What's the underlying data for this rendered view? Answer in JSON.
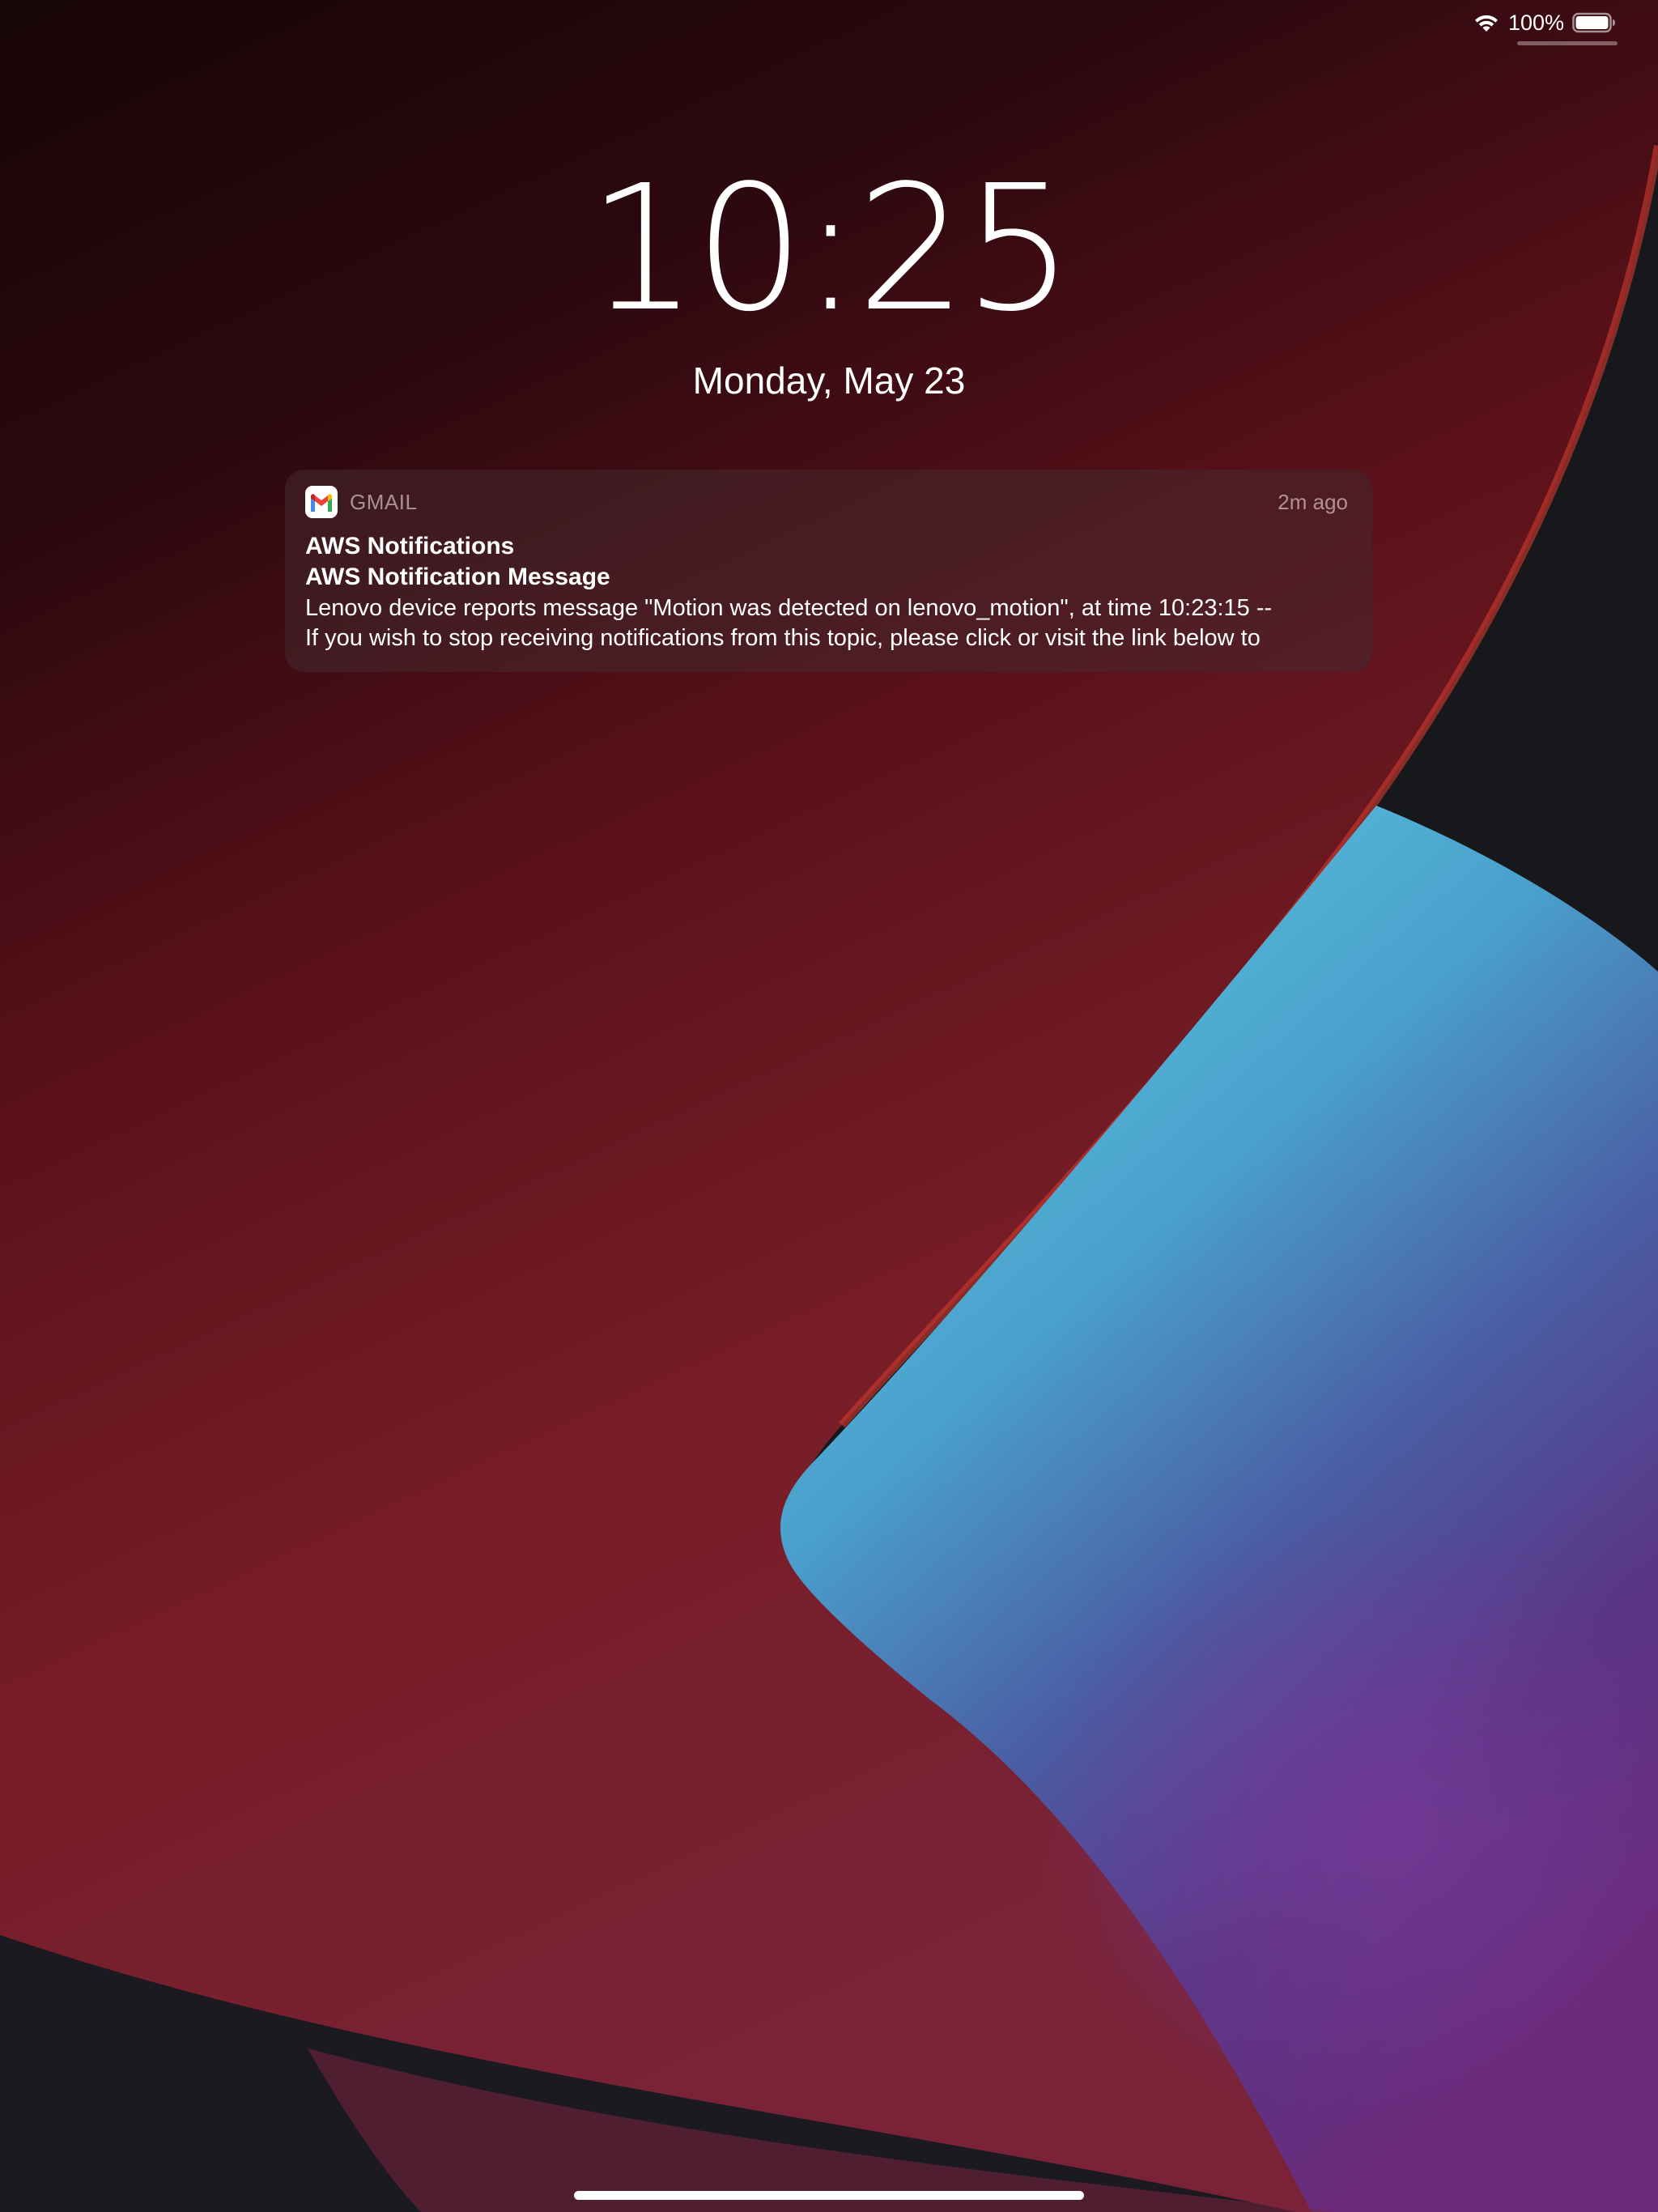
{
  "status_bar": {
    "battery_text": "100%",
    "wifi_icon": "wifi-icon",
    "battery_icon": "battery-icon",
    "battery_level": 1.0
  },
  "lock_screen": {
    "time": "10:25",
    "date": "Monday, May 23"
  },
  "notification": {
    "app_icon": "gmail-icon",
    "app_name": "GMAIL",
    "time_ago": "2m ago",
    "title": "AWS Notifications",
    "subtitle": "AWS Notification Message",
    "body_line_1": "Lenovo device reports message \"Motion was detected on lenovo_motion\", at time 10:23:15 --",
    "body_line_2": "If you wish to stop receiving notifications from this topic, please click or visit the link below to"
  },
  "colors": {
    "wallpaper_red": "#8a1f28",
    "wallpaper_blue": "#52b9d8",
    "wallpaper_purple": "#6b2a7a",
    "background_dark": "#17181c"
  }
}
